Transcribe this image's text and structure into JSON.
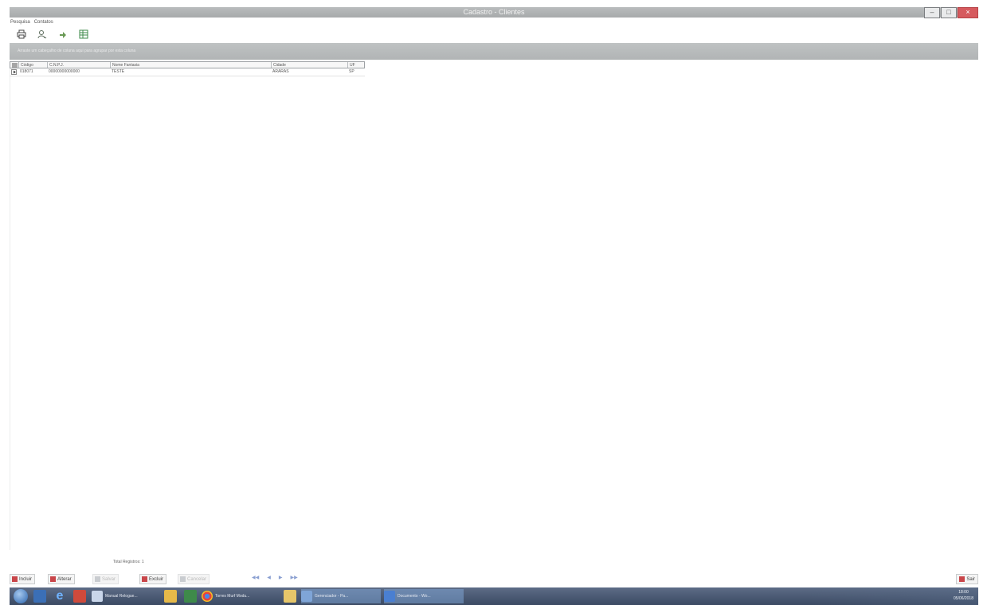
{
  "window": {
    "title": "Cadastro - Clientes",
    "buttons": [
      "–",
      "□",
      "×"
    ]
  },
  "menu": {
    "items": [
      "Pesquisa",
      "Contatos"
    ]
  },
  "toolbar": {
    "icons": [
      "print-icon",
      "user-search-icon",
      "export-icon",
      "excel-icon"
    ]
  },
  "filter": {
    "text": "Arraste um cabeçalho de coluna aqui para agrupar por esta coluna"
  },
  "grid": {
    "headers": [
      "Código",
      "C.N.P.J.",
      "Nome Fantasia",
      "Cidade",
      "UF"
    ],
    "rows": [
      [
        "018071",
        "00000000000000",
        "TESTE",
        "ARARAS",
        "SP"
      ]
    ]
  },
  "footer": {
    "total_label": "Total Registros: 1"
  },
  "actions": {
    "incluir": "Incluir",
    "alterar": "Alterar",
    "salvar": "Salvar",
    "excluir": "Excluir",
    "cancelar": "Cancelar",
    "nav": [
      "◀◀",
      "◀",
      "▶",
      "▶▶"
    ],
    "sair": "Sair"
  },
  "taskbar": {
    "tasks": [
      "Manual Relogue...",
      "Torres Murf Modu...",
      "Gerenciador - Pa...",
      "Documento - Wo..."
    ],
    "time": "18:00",
    "date": "05/06/2018"
  },
  "colors": {
    "title_bar": "#a9acad",
    "close_button": "#d65a5e",
    "taskbar": "#3b4a63"
  }
}
